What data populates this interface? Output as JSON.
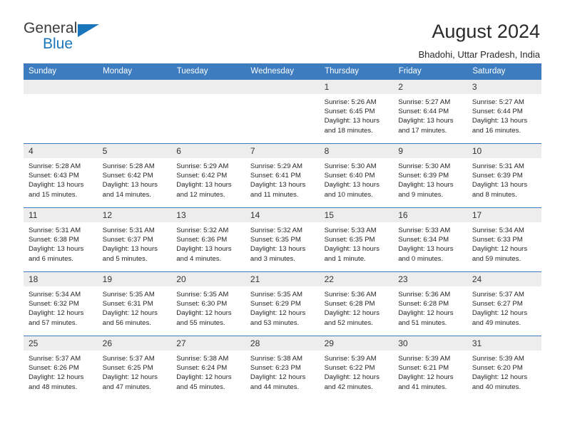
{
  "brand": {
    "name_part1": "General",
    "name_part2": "Blue",
    "triangle_color": "#1b75bb"
  },
  "header": {
    "title": "August 2024",
    "subtitle": "Bhadohi, Uttar Pradesh, India"
  },
  "theme": {
    "header_blue": "#3c7cbf",
    "daynum_gray": "#ededed",
    "text": "#262626"
  },
  "labels": {
    "sunrise_prefix": "Sunrise:",
    "sunset_prefix": "Sunset:",
    "daylight_prefix": "Daylight:"
  },
  "weekday_headers": [
    "Sunday",
    "Monday",
    "Tuesday",
    "Wednesday",
    "Thursday",
    "Friday",
    "Saturday"
  ],
  "weeks": [
    [
      {
        "day": "",
        "empty": true
      },
      {
        "day": "",
        "empty": true
      },
      {
        "day": "",
        "empty": true
      },
      {
        "day": "",
        "empty": true
      },
      {
        "day": "1",
        "sunrise": "Sunrise: 5:26 AM",
        "sunset": "Sunset: 6:45 PM",
        "daylight": "Daylight: 13 hours and 18 minutes."
      },
      {
        "day": "2",
        "sunrise": "Sunrise: 5:27 AM",
        "sunset": "Sunset: 6:44 PM",
        "daylight": "Daylight: 13 hours and 17 minutes."
      },
      {
        "day": "3",
        "sunrise": "Sunrise: 5:27 AM",
        "sunset": "Sunset: 6:44 PM",
        "daylight": "Daylight: 13 hours and 16 minutes."
      }
    ],
    [
      {
        "day": "4",
        "sunrise": "Sunrise: 5:28 AM",
        "sunset": "Sunset: 6:43 PM",
        "daylight": "Daylight: 13 hours and 15 minutes."
      },
      {
        "day": "5",
        "sunrise": "Sunrise: 5:28 AM",
        "sunset": "Sunset: 6:42 PM",
        "daylight": "Daylight: 13 hours and 14 minutes."
      },
      {
        "day": "6",
        "sunrise": "Sunrise: 5:29 AM",
        "sunset": "Sunset: 6:42 PM",
        "daylight": "Daylight: 13 hours and 12 minutes."
      },
      {
        "day": "7",
        "sunrise": "Sunrise: 5:29 AM",
        "sunset": "Sunset: 6:41 PM",
        "daylight": "Daylight: 13 hours and 11 minutes."
      },
      {
        "day": "8",
        "sunrise": "Sunrise: 5:30 AM",
        "sunset": "Sunset: 6:40 PM",
        "daylight": "Daylight: 13 hours and 10 minutes."
      },
      {
        "day": "9",
        "sunrise": "Sunrise: 5:30 AM",
        "sunset": "Sunset: 6:39 PM",
        "daylight": "Daylight: 13 hours and 9 minutes."
      },
      {
        "day": "10",
        "sunrise": "Sunrise: 5:31 AM",
        "sunset": "Sunset: 6:39 PM",
        "daylight": "Daylight: 13 hours and 8 minutes."
      }
    ],
    [
      {
        "day": "11",
        "sunrise": "Sunrise: 5:31 AM",
        "sunset": "Sunset: 6:38 PM",
        "daylight": "Daylight: 13 hours and 6 minutes."
      },
      {
        "day": "12",
        "sunrise": "Sunrise: 5:31 AM",
        "sunset": "Sunset: 6:37 PM",
        "daylight": "Daylight: 13 hours and 5 minutes."
      },
      {
        "day": "13",
        "sunrise": "Sunrise: 5:32 AM",
        "sunset": "Sunset: 6:36 PM",
        "daylight": "Daylight: 13 hours and 4 minutes."
      },
      {
        "day": "14",
        "sunrise": "Sunrise: 5:32 AM",
        "sunset": "Sunset: 6:35 PM",
        "daylight": "Daylight: 13 hours and 3 minutes."
      },
      {
        "day": "15",
        "sunrise": "Sunrise: 5:33 AM",
        "sunset": "Sunset: 6:35 PM",
        "daylight": "Daylight: 13 hours and 1 minute."
      },
      {
        "day": "16",
        "sunrise": "Sunrise: 5:33 AM",
        "sunset": "Sunset: 6:34 PM",
        "daylight": "Daylight: 13 hours and 0 minutes."
      },
      {
        "day": "17",
        "sunrise": "Sunrise: 5:34 AM",
        "sunset": "Sunset: 6:33 PM",
        "daylight": "Daylight: 12 hours and 59 minutes."
      }
    ],
    [
      {
        "day": "18",
        "sunrise": "Sunrise: 5:34 AM",
        "sunset": "Sunset: 6:32 PM",
        "daylight": "Daylight: 12 hours and 57 minutes."
      },
      {
        "day": "19",
        "sunrise": "Sunrise: 5:35 AM",
        "sunset": "Sunset: 6:31 PM",
        "daylight": "Daylight: 12 hours and 56 minutes."
      },
      {
        "day": "20",
        "sunrise": "Sunrise: 5:35 AM",
        "sunset": "Sunset: 6:30 PM",
        "daylight": "Daylight: 12 hours and 55 minutes."
      },
      {
        "day": "21",
        "sunrise": "Sunrise: 5:35 AM",
        "sunset": "Sunset: 6:29 PM",
        "daylight": "Daylight: 12 hours and 53 minutes."
      },
      {
        "day": "22",
        "sunrise": "Sunrise: 5:36 AM",
        "sunset": "Sunset: 6:28 PM",
        "daylight": "Daylight: 12 hours and 52 minutes."
      },
      {
        "day": "23",
        "sunrise": "Sunrise: 5:36 AM",
        "sunset": "Sunset: 6:28 PM",
        "daylight": "Daylight: 12 hours and 51 minutes."
      },
      {
        "day": "24",
        "sunrise": "Sunrise: 5:37 AM",
        "sunset": "Sunset: 6:27 PM",
        "daylight": "Daylight: 12 hours and 49 minutes."
      }
    ],
    [
      {
        "day": "25",
        "sunrise": "Sunrise: 5:37 AM",
        "sunset": "Sunset: 6:26 PM",
        "daylight": "Daylight: 12 hours and 48 minutes."
      },
      {
        "day": "26",
        "sunrise": "Sunrise: 5:37 AM",
        "sunset": "Sunset: 6:25 PM",
        "daylight": "Daylight: 12 hours and 47 minutes."
      },
      {
        "day": "27",
        "sunrise": "Sunrise: 5:38 AM",
        "sunset": "Sunset: 6:24 PM",
        "daylight": "Daylight: 12 hours and 45 minutes."
      },
      {
        "day": "28",
        "sunrise": "Sunrise: 5:38 AM",
        "sunset": "Sunset: 6:23 PM",
        "daylight": "Daylight: 12 hours and 44 minutes."
      },
      {
        "day": "29",
        "sunrise": "Sunrise: 5:39 AM",
        "sunset": "Sunset: 6:22 PM",
        "daylight": "Daylight: 12 hours and 42 minutes."
      },
      {
        "day": "30",
        "sunrise": "Sunrise: 5:39 AM",
        "sunset": "Sunset: 6:21 PM",
        "daylight": "Daylight: 12 hours and 41 minutes."
      },
      {
        "day": "31",
        "sunrise": "Sunrise: 5:39 AM",
        "sunset": "Sunset: 6:20 PM",
        "daylight": "Daylight: 12 hours and 40 minutes."
      }
    ]
  ]
}
